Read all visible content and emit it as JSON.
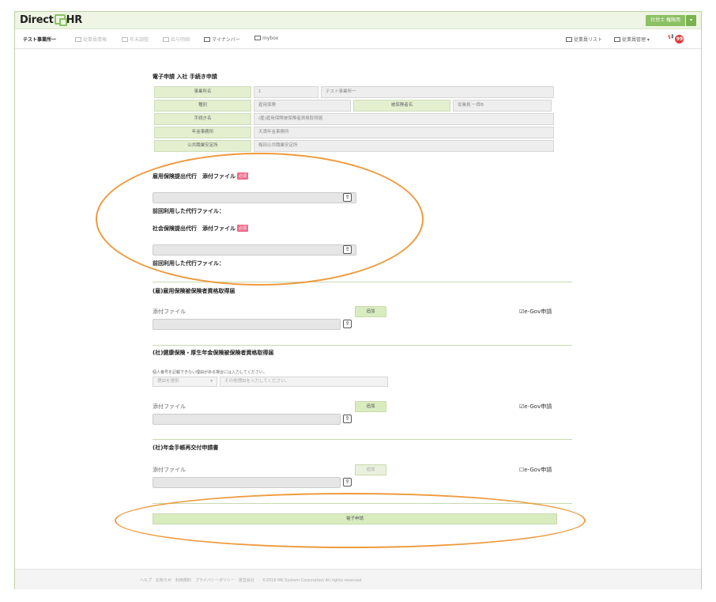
{
  "header": {
    "logo_pre": "Direct",
    "logo_post": "HR",
    "user_label": "社労士 権限用",
    "user_caret": "▾"
  },
  "nav": {
    "company": "テスト事業所一",
    "items": [
      "従業員情報",
      "年末調整",
      "給与明細",
      "マイナンバー",
      "mybox"
    ],
    "right": [
      "従業員リスト",
      "従業員管理 ▾"
    ],
    "badge": "99"
  },
  "page": {
    "title": "電子申請 入社 手続き申請",
    "info": [
      {
        "label": "事業所名",
        "values": [
          "1",
          "テスト事業所一"
        ]
      },
      {
        "label": "種別",
        "values": [
          "雇用保険"
        ],
        "label2": "被保険者名",
        "value2": "従業員 一郎B"
      },
      {
        "label": "手続き名",
        "values": [
          "(雇)雇用保険被保険者資格取得届"
        ]
      },
      {
        "label": "年金事務所",
        "values": [
          "天満年金事務所"
        ]
      },
      {
        "label": "公共職業安定所",
        "values": [
          "梅田公共職業安定所"
        ]
      }
    ]
  },
  "agency": {
    "koyo_title": "雇用保険提出代行　添付ファイル",
    "required": "必須",
    "prev_file": "前回利用した代行ファイル：",
    "shakai_title": "社会保険提出代行　添付ファイル"
  },
  "sections": [
    {
      "title": "(雇)雇用保険被保険者資格取得届",
      "attach": "添付ファイル",
      "add": "追加",
      "egov": "☑e-Gov申請"
    },
    {
      "title": "(社)健康保険・厚生年金保険被保険者資格取得届",
      "note": "個人番号を記載できない理由がある場合には入力してください。",
      "select": "理由を選択",
      "select_caret": "▾",
      "reason_placeholder": "その他理由を入力してください。",
      "attach": "添付ファイル",
      "add": "追加",
      "egov": "☑e-Gov申請"
    },
    {
      "title": "(社)年金手帳再交付申請書",
      "attach": "添付ファイル",
      "add": "追加",
      "egov": "☐e-Gov申請"
    }
  ],
  "submit": "電子申請",
  "footer": "ヘルプ　お知らせ　利用規約　プライバシーポリシー　運営会社　　©2018 MK System Corporation All rights reserved.",
  "colors": {
    "accent": "#8cc063",
    "annotation": "#ee9a3c",
    "badge": "#e23b3b"
  }
}
